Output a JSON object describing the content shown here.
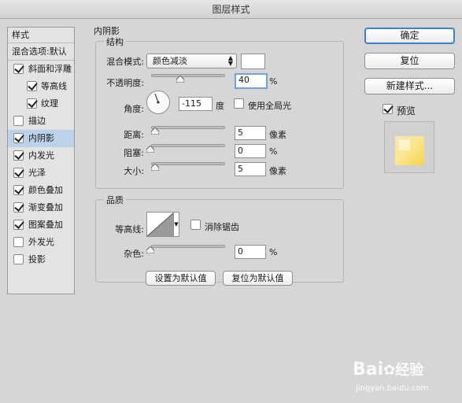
{
  "window": {
    "title": "图层样式"
  },
  "styles_list": {
    "header": "样式",
    "blend_options": "混合选项:默认",
    "items": [
      {
        "label": "斜面和浮雕",
        "checked": true,
        "sub": false
      },
      {
        "label": "等高线",
        "checked": true,
        "sub": true
      },
      {
        "label": "纹理",
        "checked": true,
        "sub": true
      },
      {
        "label": "描边",
        "checked": false,
        "sub": false
      },
      {
        "label": "内阴影",
        "checked": true,
        "sub": false,
        "selected": true
      },
      {
        "label": "内发光",
        "checked": true,
        "sub": false
      },
      {
        "label": "光泽",
        "checked": true,
        "sub": false
      },
      {
        "label": "颜色叠加",
        "checked": true,
        "sub": false
      },
      {
        "label": "渐变叠加",
        "checked": true,
        "sub": false
      },
      {
        "label": "图案叠加",
        "checked": true,
        "sub": false
      },
      {
        "label": "外发光",
        "checked": false,
        "sub": false
      },
      {
        "label": "投影",
        "checked": false,
        "sub": false
      }
    ]
  },
  "inner_shadow": {
    "title": "内阴影",
    "structure": {
      "title": "结构",
      "blend_mode_label": "混合模式:",
      "blend_mode_value": "颜色减淡",
      "blend_color": "#ffffff",
      "opacity_label": "不透明度:",
      "opacity_value": "40",
      "opacity_unit": "%",
      "angle_label": "角度:",
      "angle_value": "-115",
      "angle_unit": "度",
      "global_light_label": "使用全局光",
      "global_light_checked": false,
      "distance_label": "距离:",
      "distance_value": "5",
      "distance_unit": "像素",
      "choke_label": "阻塞:",
      "choke_value": "0",
      "choke_unit": "%",
      "size_label": "大小:",
      "size_value": "5",
      "size_unit": "像素"
    },
    "quality": {
      "title": "品质",
      "contour_label": "等高线:",
      "antialias_label": "消除锯齿",
      "antialias_checked": false,
      "noise_label": "杂色:",
      "noise_value": "0",
      "noise_unit": "%"
    },
    "make_default_label": "设置为默认值",
    "reset_default_label": "复位为默认值"
  },
  "actions": {
    "ok_label": "确定",
    "reset_label": "复位",
    "new_style_label": "新建样式...",
    "preview_label": "预览",
    "preview_checked": true
  },
  "watermark": {
    "brand": "Bai",
    "brand2": "经验",
    "url": "jingyan.baidu.com"
  }
}
